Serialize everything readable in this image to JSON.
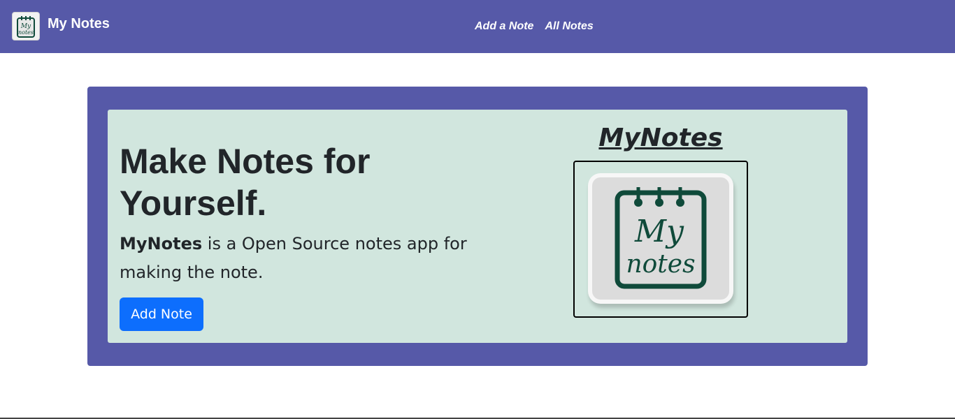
{
  "navbar": {
    "brand": "My Notes",
    "links": [
      "Add a Note",
      "All Notes"
    ],
    "bg_color": "#5659a8",
    "logo_text": [
      "My",
      "notes"
    ]
  },
  "hero": {
    "title": "Make Notes for Yourself.",
    "desc_bold": "MyNotes",
    "desc_rest": " is a Open Source notes app for making the note.",
    "button_label": "Add Note",
    "button_color": "#0d6efd",
    "panel_color": "#d1e6de",
    "logo_heading": "MyNotes",
    "logo_text": [
      "My",
      "notes"
    ],
    "logo_ink_color": "#0f4a3a"
  }
}
